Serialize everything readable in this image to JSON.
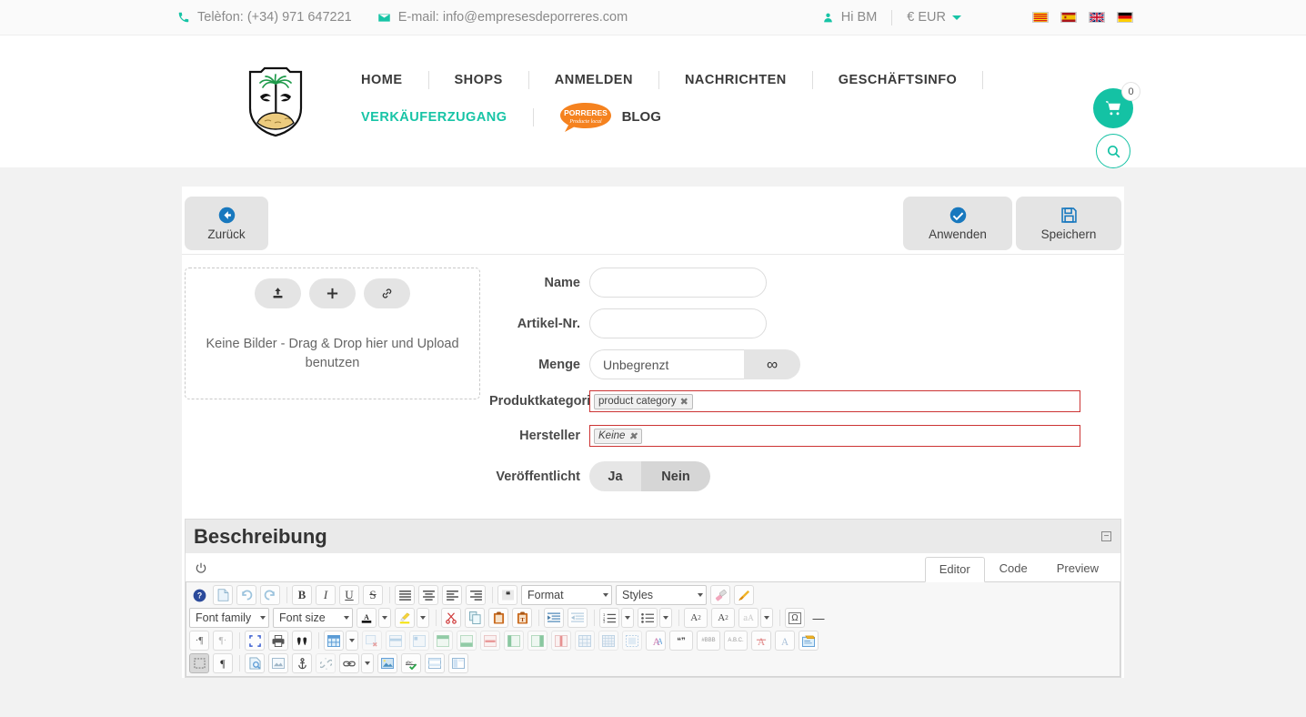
{
  "topbar": {
    "phone_icon": "phone-icon",
    "phone": "Telèfon: (+34) 971 647221",
    "email_icon": "envelope-icon",
    "email": "E-mail: info@empresesdeporreres.com",
    "user_icon": "user-icon",
    "greeting": "Hi BM",
    "currency": "€ EUR",
    "flags": [
      {
        "name": "flag-catalan",
        "colors": [
          "#FCDD09",
          "#DA121A"
        ]
      },
      {
        "name": "flag-spain",
        "colors": [
          "#AA151B",
          "#F1BF00"
        ]
      },
      {
        "name": "flag-uk",
        "colors": [
          "#012169",
          "#FFFFFF",
          "#C8102E"
        ]
      },
      {
        "name": "flag-germany",
        "colors": [
          "#000000",
          "#DD0000",
          "#FFCE00"
        ]
      }
    ]
  },
  "header": {
    "logo_alt": "Porreres coat of arms shield with palm tree and two birds",
    "nav_primary": [
      "HOME",
      "SHOPS",
      "ANMELDEN",
      "NACHRICHTEN",
      "GESCHÄFTSINFO"
    ],
    "nav_secondary": "VERKÄUFERZUGANG",
    "blog_badge_line1": "PORRERES",
    "blog_badge_line2": "Producte local",
    "blog_label": "BLOG",
    "cart_count": "0",
    "cart_icon": "shopping-cart-icon",
    "search_icon": "search-icon",
    "accent_color": "#14c2a4"
  },
  "admin_toolbar": {
    "back_label": "Zurück",
    "back_icon": "arrow-circle-left-icon",
    "apply_label": "Anwenden",
    "apply_icon": "check-circle-icon",
    "save_label": "Speichern",
    "save_icon": "floppy-disk-icon",
    "icon_color": "#1878be"
  },
  "media": {
    "upload_icon": "upload-icon",
    "add_icon": "plus-icon",
    "link_icon": "link-icon",
    "empty_text": "Keine Bilder - Drag & Drop hier und Upload benutzen"
  },
  "form": {
    "name_label": "Name",
    "name_value": "",
    "sku_label": "Artikel-Nr.",
    "sku_value": "",
    "qty_label": "Menge",
    "qty_value": "Unbegrenzt",
    "qty_button_icon": "infinity-icon",
    "qty_button_glyph": "∞",
    "category_label": "Produktkategorie",
    "category_tag": "product category",
    "manufacturer_label": "Hersteller",
    "manufacturer_tag": "Keine",
    "published_label": "Veröffentlicht",
    "published_yes": "Ja",
    "published_no": "Nein",
    "published_selected": "Nein"
  },
  "description": {
    "title": "Beschreibung",
    "collapse_glyph": "−",
    "power_icon": "power-icon",
    "tabs": [
      {
        "label": "Editor",
        "active": true
      },
      {
        "label": "Code",
        "active": false
      },
      {
        "label": "Preview",
        "active": false
      }
    ]
  },
  "editor_toolbar": {
    "row1": [
      {
        "name": "help-icon",
        "glyph": "?"
      },
      {
        "name": "new-page-icon",
        "glyph": "📄"
      },
      {
        "name": "undo-icon",
        "glyph": "↺"
      },
      {
        "name": "redo-icon",
        "glyph": "↻"
      },
      {
        "name": "bold-icon",
        "glyph": "B"
      },
      {
        "name": "italic-icon",
        "glyph": "I"
      },
      {
        "name": "underline-icon",
        "glyph": "U"
      },
      {
        "name": "strikethrough-icon",
        "glyph": "S"
      },
      {
        "name": "align-justify-icon",
        "glyph": "≣"
      },
      {
        "name": "align-center-icon",
        "glyph": "≡"
      },
      {
        "name": "align-left-icon",
        "glyph": "≡"
      },
      {
        "name": "align-right-icon",
        "glyph": "≡"
      },
      {
        "name": "blockquote-icon",
        "glyph": "❝"
      }
    ],
    "format_select": "Format",
    "styles_select": "Styles",
    "row1_end": [
      {
        "name": "remove-format-icon",
        "glyph": "⌫"
      },
      {
        "name": "paint-brush-icon",
        "glyph": "🖌"
      }
    ],
    "font_family_select": "Font family",
    "font_size_select": "Font size",
    "row2": [
      {
        "name": "text-color-icon",
        "glyph": "A"
      },
      {
        "name": "background-color-icon",
        "glyph": "🖍"
      },
      {
        "name": "cut-icon",
        "glyph": "✂"
      },
      {
        "name": "copy-icon",
        "glyph": "⧉"
      },
      {
        "name": "paste-icon",
        "glyph": "📋"
      },
      {
        "name": "paste-text-icon",
        "glyph": "T"
      },
      {
        "name": "outdent-icon",
        "glyph": "⇤"
      },
      {
        "name": "indent-icon",
        "glyph": "⇥"
      },
      {
        "name": "numbered-list-icon",
        "glyph": "≔"
      },
      {
        "name": "bulleted-list-icon",
        "glyph": "⋮≡"
      },
      {
        "name": "subscript-icon",
        "glyph": "A₂"
      },
      {
        "name": "superscript-icon",
        "glyph": "A²"
      },
      {
        "name": "text-case-icon",
        "glyph": "aA"
      },
      {
        "name": "special-character-icon",
        "glyph": "Ω"
      },
      {
        "name": "horizontal-rule-icon",
        "glyph": "—"
      }
    ],
    "row3": [
      {
        "name": "text-direction-ltr-icon",
        "glyph": "¶"
      },
      {
        "name": "text-direction-rtl-icon",
        "glyph": "¶"
      },
      {
        "name": "maximize-icon",
        "glyph": "⛶"
      },
      {
        "name": "print-icon",
        "glyph": "🖨"
      },
      {
        "name": "find-icon",
        "glyph": "🔍"
      },
      {
        "name": "table-icon",
        "glyph": "▦"
      },
      {
        "name": "delete-table-icon",
        "glyph": "▦"
      },
      {
        "name": "table-row-icon",
        "glyph": "▤"
      },
      {
        "name": "table-cell-icon",
        "glyph": "▥"
      },
      {
        "name": "insert-row-above-icon",
        "glyph": "▤"
      },
      {
        "name": "insert-row-below-icon",
        "glyph": "▤"
      },
      {
        "name": "delete-row-icon",
        "glyph": "▤"
      },
      {
        "name": "insert-col-left-icon",
        "glyph": "▥"
      },
      {
        "name": "insert-col-right-icon",
        "glyph": "▥"
      },
      {
        "name": "delete-col-icon",
        "glyph": "▥"
      },
      {
        "name": "table-properties-icon",
        "glyph": "▦"
      },
      {
        "name": "table-grid-icon",
        "glyph": "▦"
      },
      {
        "name": "div-container-icon",
        "glyph": "▢"
      },
      {
        "name": "spell-check-lang-icon",
        "glyph": "AA"
      },
      {
        "name": "quotation-icon",
        "glyph": "❝❞"
      },
      {
        "name": "abbreviation-icon",
        "glyph": "#BBB"
      },
      {
        "name": "acronym-icon",
        "glyph": "A.B.C."
      },
      {
        "name": "anchor-text-icon",
        "glyph": "A"
      },
      {
        "name": "text-field-icon",
        "glyph": "A"
      },
      {
        "name": "comment-icon",
        "glyph": "💬"
      }
    ],
    "row4": [
      {
        "name": "show-blocks-icon",
        "glyph": "⬚"
      },
      {
        "name": "paragraph-mark-icon",
        "glyph": "¶"
      },
      {
        "name": "page-properties-icon",
        "glyph": "📄"
      },
      {
        "name": "image-icon",
        "glyph": "🖼"
      },
      {
        "name": "anchor-icon",
        "glyph": "⚓"
      },
      {
        "name": "unlink-icon",
        "glyph": "⛓"
      },
      {
        "name": "link-icon",
        "glyph": "🔗"
      },
      {
        "name": "media-image-icon",
        "glyph": "🖼"
      },
      {
        "name": "spell-check-icon",
        "glyph": "abc"
      },
      {
        "name": "iframe-icon",
        "glyph": "▤"
      },
      {
        "name": "template-icon",
        "glyph": "▣"
      }
    ]
  }
}
